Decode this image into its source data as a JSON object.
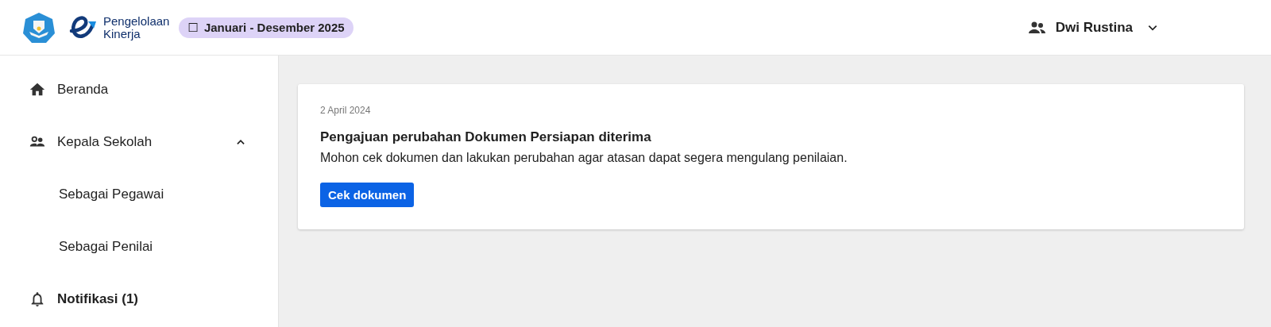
{
  "header": {
    "brand": [
      "Pengelolaan",
      "Kinerja"
    ],
    "period": {
      "icon": "☐",
      "label": "Januari - Desember 2025"
    },
    "user": {
      "name": "Dwi Rustina"
    }
  },
  "sidebar": {
    "items": [
      {
        "kind": "home",
        "label": "Beranda",
        "selected": false
      },
      {
        "kind": "group",
        "label": "Kepala Sekolah",
        "selected": false,
        "expanded": true,
        "children": [
          {
            "label": "Sebagai Pegawai",
            "selected": false
          },
          {
            "label": "Sebagai Penilai",
            "selected": false
          }
        ]
      },
      {
        "kind": "bell",
        "label": "Notifikasi (1)",
        "selected": true
      }
    ]
  },
  "notifications": [
    {
      "date": "2 April 2024",
      "title": "Pengajuan perubahan Dokumen Persiapan diterima",
      "message": "Mohon cek dokumen dan lakukan perubahan agar atasan dapat segera mengulang penilaian.",
      "action": "Cek dokumen"
    }
  ]
}
